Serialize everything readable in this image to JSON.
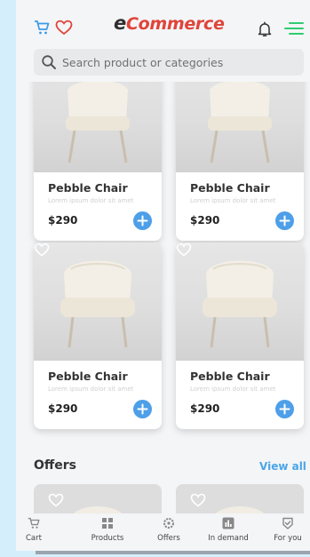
{
  "app": {
    "brand_letter": "e",
    "brand_rest": "Commerce"
  },
  "search": {
    "placeholder": "Search product or categories"
  },
  "products": [
    {
      "title": "Pebble Chair",
      "desc": "Lorem ipsum dolor sit amet",
      "price": "$290"
    },
    {
      "title": "Pebble Chair",
      "desc": "Lorem ipsum dolor sit amet",
      "price": "$290"
    },
    {
      "title": "Pebble Chair",
      "desc": "Lorem ipsum dolor sit amet",
      "price": "$290"
    },
    {
      "title": "Pebble Chair",
      "desc": "Lorem ipsum dolor sit amet",
      "price": "$290"
    }
  ],
  "offers": {
    "title": "Offers",
    "view_all": "View all"
  },
  "nav": [
    {
      "label": "Cart",
      "icon": "cart-icon"
    },
    {
      "label": "Products",
      "icon": "grid-icon"
    },
    {
      "label": "Offers",
      "icon": "gear-badge-icon"
    },
    {
      "label": "In demand",
      "icon": "bar-chart-icon"
    },
    {
      "label": "For you",
      "icon": "shield-check-icon"
    }
  ],
  "colors": {
    "accent": "#4d9fe8",
    "brand": "#e0443a",
    "icon_blue": "#3b9be6",
    "menu_green": "#2ecc71",
    "background": "#d5eefb"
  }
}
